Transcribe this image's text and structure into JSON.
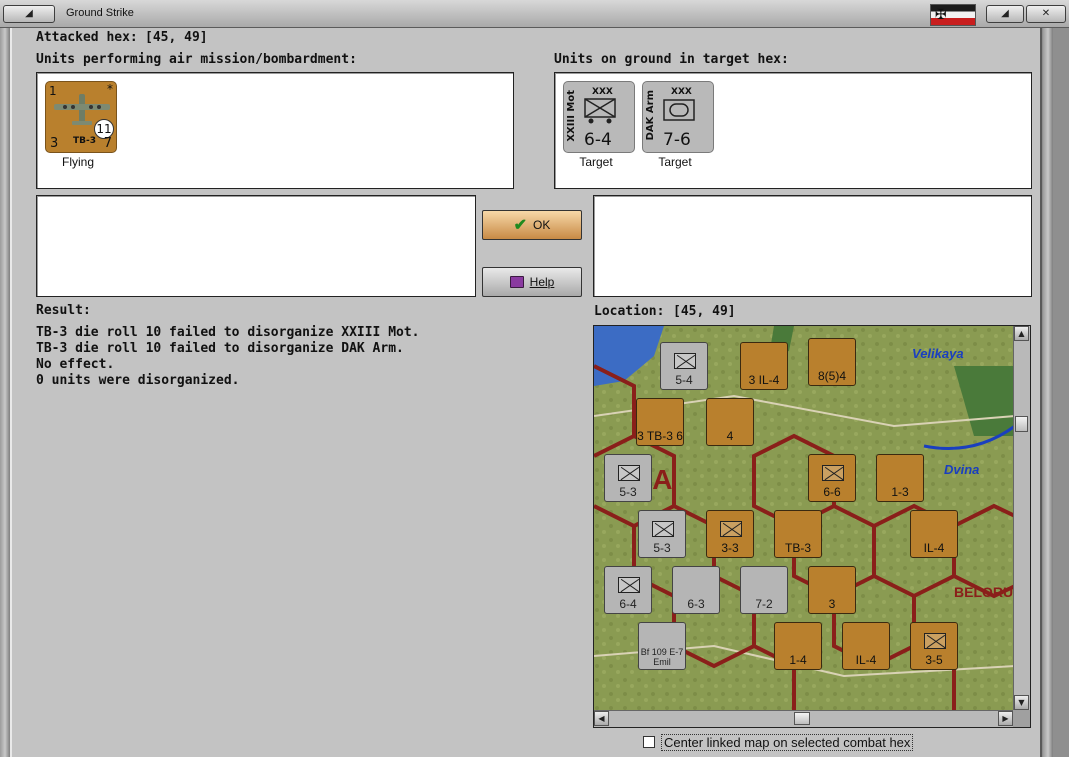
{
  "window": {
    "title": "Ground Strike",
    "controls": {
      "left": "◢",
      "right_min": "◢",
      "right_close": "✕"
    }
  },
  "header": {
    "attacked_label": "Attacked hex:",
    "attacked_value": "[45, 49]",
    "air_label": "Units performing air mission/bombardment:",
    "ground_label": "Units on ground in target hex:"
  },
  "air_units": [
    {
      "name": "TB-3",
      "top_left": "1",
      "top_right": "*",
      "bottom_left": "3",
      "bottom_right": "7",
      "badge": "11",
      "status": "Flying",
      "icon": "bomber-plane-icon"
    }
  ],
  "ground_units": [
    {
      "name": "XXIII Mot",
      "size": "XXX",
      "strength": "6-4",
      "status": "Target",
      "icon": "motorized-infantry-icon"
    },
    {
      "name": "DAK Arm",
      "size": "XXX",
      "strength": "7-6",
      "status": "Target",
      "icon": "armor-icon"
    }
  ],
  "buttons": {
    "ok": "OK",
    "help": "Help"
  },
  "result": {
    "label": "Result:",
    "lines": [
      "TB-3 die roll 10 failed to disorganize XXIII Mot.",
      "TB-3 die roll 10 failed to disorganize DAK Arm.",
      "No effect.",
      "0 units were disorganized."
    ]
  },
  "location": {
    "label": "Location:",
    "value": "[45, 49]"
  },
  "map": {
    "labels": {
      "velikaya": "Velikaya",
      "dvina": "Dvina",
      "nia": "ANIA",
      "belor": "BELORU"
    },
    "counters": [
      {
        "label": "5-4",
        "style": "grey"
      },
      {
        "label": "3 IL-4",
        "style": "brown"
      },
      {
        "label": "8(5)4",
        "style": "brown"
      },
      {
        "label": "3 TB-3 6",
        "style": "brown"
      },
      {
        "label": "4",
        "style": "brown"
      },
      {
        "label": "5-3",
        "style": "grey"
      },
      {
        "label": "6-6",
        "style": "brown"
      },
      {
        "label": "1-3",
        "style": "brown"
      },
      {
        "label": "5-3",
        "style": "grey"
      },
      {
        "label": "3-3",
        "style": "brown"
      },
      {
        "label": "TB-3",
        "style": "brown"
      },
      {
        "label": "IL-4",
        "style": "brown"
      },
      {
        "label": "6-4",
        "style": "grey"
      },
      {
        "label": "6-3",
        "style": "grey"
      },
      {
        "label": "7-2",
        "style": "grey"
      },
      {
        "label": "3",
        "style": "brown"
      },
      {
        "label": "Bf 109 E-7 Emil",
        "style": "grey"
      },
      {
        "label": "1-4",
        "style": "brown"
      },
      {
        "label": "IL-4",
        "style": "brown"
      },
      {
        "label": "3-5",
        "style": "brown"
      }
    ]
  },
  "options": {
    "center_map_label": "Center linked map on selected combat hex",
    "center_map_checked": false
  },
  "colors": {
    "dialog_bg": "#c3c3c3",
    "counter_brown": "#b9802d",
    "counter_grey": "#b9b9b9",
    "border_red": "#8a1f1a",
    "river_blue": "#1a3fbf"
  }
}
